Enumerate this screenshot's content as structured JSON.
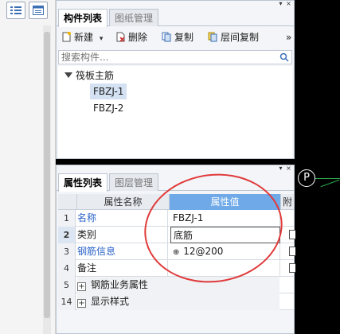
{
  "component_panel": {
    "tabs": [
      {
        "label": "构件列表",
        "active": true
      },
      {
        "label": "图纸管理",
        "active": false
      }
    ],
    "toolbar": {
      "new_label": "新建",
      "delete_label": "删除",
      "copy_label": "复制",
      "floor_copy_label": "层间复制",
      "more_glyph": "»"
    },
    "search_placeholder": "搜索构件...",
    "tree": {
      "root_label": "筏板主筋",
      "children": [
        {
          "label": "FBZJ-1",
          "selected": true
        },
        {
          "label": "FBZJ-2",
          "selected": false
        }
      ]
    }
  },
  "property_panel": {
    "tabs": [
      {
        "label": "属性列表",
        "active": true
      },
      {
        "label": "图层管理",
        "active": false
      }
    ],
    "columns": [
      "属性名称",
      "属性值",
      "附"
    ],
    "rows": [
      {
        "num": "1",
        "name": "名称",
        "value": "FBZJ-1"
      },
      {
        "num": "2",
        "name": "类别",
        "value": "底筋"
      },
      {
        "num": "3",
        "name": "钢筋信息",
        "value": " 12@200"
      },
      {
        "num": "4",
        "name": "备注",
        "value": ""
      },
      {
        "num": "5",
        "name": "钢筋业务属性",
        "value": ""
      },
      {
        "num": "14",
        "name": "显示样式",
        "value": ""
      }
    ]
  },
  "canvas": {
    "marker_label": "P"
  },
  "colors": {
    "active_header": "#6fa9e8",
    "link_text": "#2a62c9",
    "annotation": "#e03a3a",
    "selection": "#d3e1f3"
  }
}
